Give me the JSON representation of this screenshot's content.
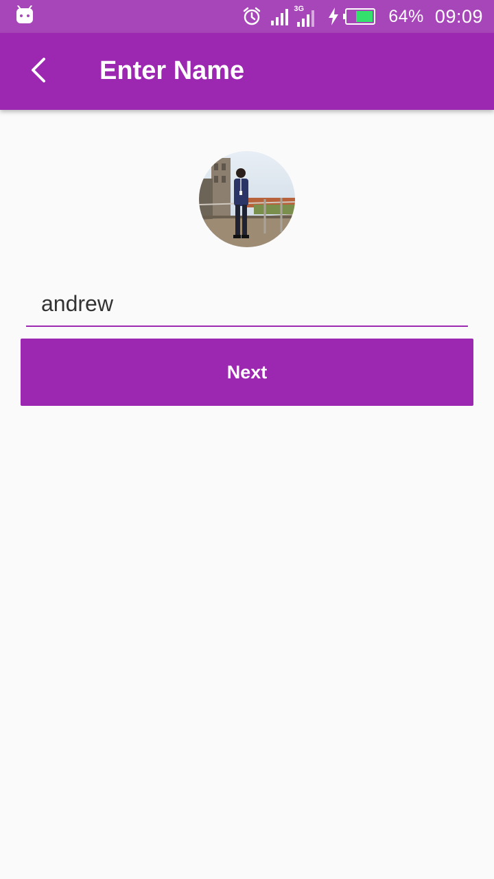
{
  "status_bar": {
    "battery_percent_text": "64%",
    "battery_level": 0.64,
    "time": "09:09",
    "network_type": "3G",
    "icons": [
      "android-notification-icon",
      "alarm-icon",
      "signal-icon",
      "3g-signal-icon",
      "charging-icon",
      "battery-icon"
    ],
    "colors": {
      "background": "#a746b9",
      "battery_fill": "#33e06b"
    }
  },
  "app_bar": {
    "title": "Enter Name",
    "back_icon": "back-arrow-icon",
    "color": "#9c27b0"
  },
  "profile": {
    "avatar_icon": "profile-photo"
  },
  "form": {
    "name_value": "andrew",
    "next_label": "Next"
  }
}
